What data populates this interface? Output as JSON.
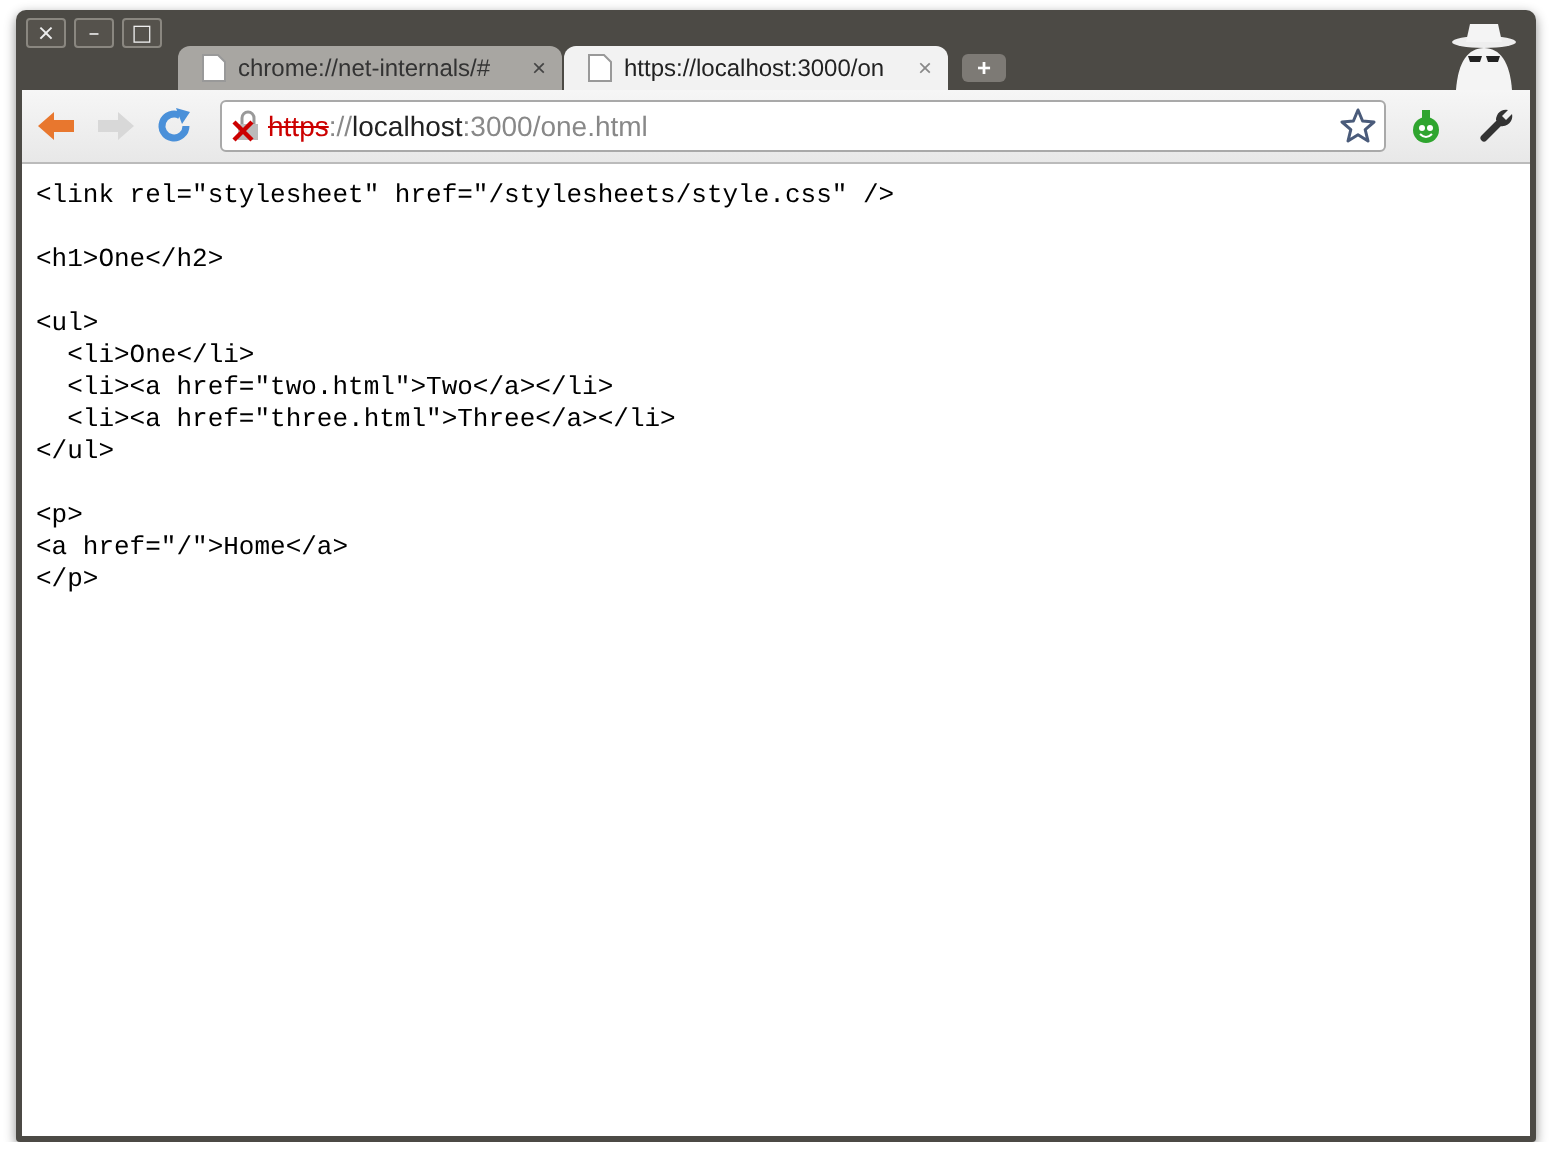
{
  "window": {
    "controls": [
      "×",
      "–",
      "□"
    ]
  },
  "tabs": [
    {
      "title": "chrome://net-internals/#",
      "close": "×",
      "selected": false
    },
    {
      "title": "https://localhost:3000/on",
      "close": "×",
      "selected": true
    }
  ],
  "new_tab": "+",
  "address_bar": {
    "scheme": "https",
    "scheme_broken": true,
    "separator": "://",
    "host": "localhost",
    "path": ":3000/one.html"
  },
  "toolbar": {
    "forward_enabled": false
  },
  "content": {
    "blocks": [
      [
        "<link rel=\"stylesheet\" href=\"/stylesheets/style.css\" />"
      ],
      [
        "<h1>One</h2>"
      ],
      [
        "<ul>",
        "  <li>One</li>",
        "  <li><a href=\"two.html\">Two</a></li>",
        "  <li><a href=\"three.html\">Three</a></li>",
        "</ul>"
      ],
      [
        "<p>",
        "<a href=\"/\">Home</a>",
        "</p>"
      ]
    ]
  }
}
